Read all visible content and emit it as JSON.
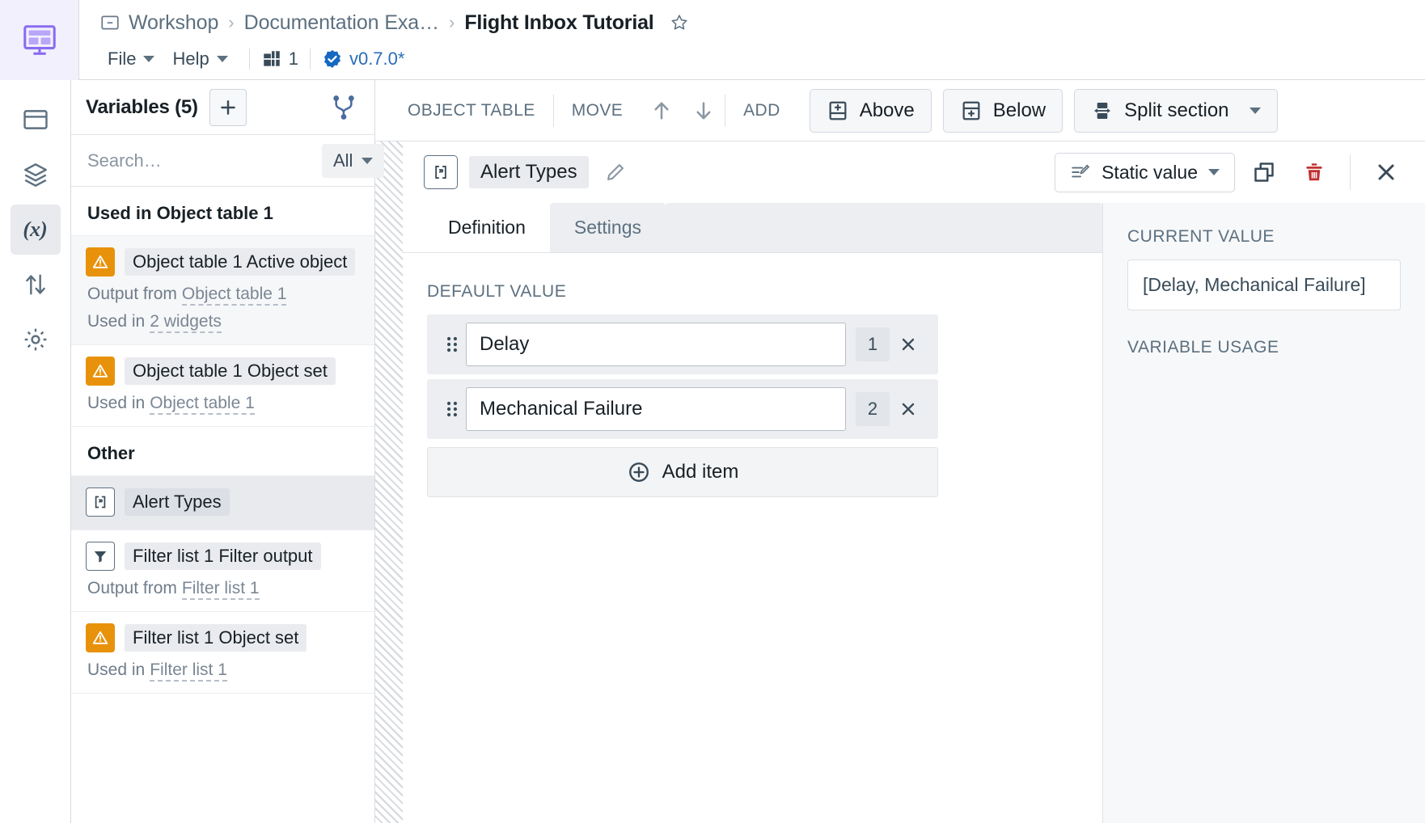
{
  "app": {
    "logo_icon": "workshop-layout-icon"
  },
  "breadcrumb": {
    "folder_icon": "folder-icon",
    "items": [
      {
        "label": "Workshop"
      },
      {
        "label": "Documentation Exa…"
      }
    ],
    "separator": "›",
    "current": "Flight Inbox Tutorial",
    "star_icon": "star-outline-icon"
  },
  "menubar": {
    "items": [
      {
        "label": "File",
        "icon": "chevron-down-icon"
      },
      {
        "label": "Help",
        "icon": "chevron-down-icon"
      }
    ],
    "layout_icon": "layout-grid-icon",
    "layout_count": "1",
    "version_icon": "verified-badge-icon",
    "version_label": "v0.7.0*"
  },
  "rail": {
    "items": [
      {
        "name": "layout-panel-icon",
        "active": false
      },
      {
        "name": "layers-icon",
        "active": false
      },
      {
        "name": "variables-icon",
        "active": true,
        "glyph": "(x)"
      },
      {
        "name": "transfer-arrows-icon",
        "active": false
      },
      {
        "name": "gear-icon",
        "active": false
      }
    ]
  },
  "variables_panel": {
    "title": "Variables (5)",
    "add_icon": "plus-icon",
    "add_label": "+",
    "branch_icon": "branch-icon",
    "search": {
      "placeholder": "Search…",
      "value": ""
    },
    "filter": {
      "label": "All",
      "icon": "chevron-down-icon"
    },
    "groups": [
      {
        "title": "Used in Object table 1",
        "items": [
          {
            "icon": "warning-triangle-icon",
            "icon_kind": "warn",
            "name": "Object table 1 Active object",
            "selected": false,
            "tinted": true,
            "meta": [
              {
                "prefix": "Output from",
                "link": "Object table 1"
              },
              {
                "prefix": "Used in",
                "link": "2 widgets"
              }
            ]
          },
          {
            "icon": "warning-triangle-icon",
            "icon_kind": "warn",
            "name": "Object table 1 Object set",
            "selected": false,
            "tinted": false,
            "meta": [
              {
                "prefix": "Used in",
                "link": "Object table 1"
              }
            ]
          }
        ]
      },
      {
        "title": "Other",
        "items": [
          {
            "icon": "variable-bracket-icon",
            "icon_kind": "outline",
            "name": "Alert Types",
            "selected": true,
            "tinted": false,
            "meta": []
          },
          {
            "icon": "filter-funnel-icon",
            "icon_kind": "outline",
            "name": "Filter list 1 Filter output",
            "selected": false,
            "tinted": false,
            "meta": [
              {
                "prefix": "Output from",
                "link": "Filter list 1"
              }
            ]
          },
          {
            "icon": "warning-triangle-icon",
            "icon_kind": "warn",
            "name": "Filter list 1 Object set",
            "selected": false,
            "tinted": false,
            "meta": [
              {
                "prefix": "Used in",
                "link": "Filter list 1"
              }
            ]
          }
        ]
      }
    ]
  },
  "section_toolbar": {
    "object_table_label": "OBJECT TABLE",
    "move_label": "MOVE",
    "move_up_icon": "arrow-up-icon",
    "move_down_icon": "arrow-down-icon",
    "add_label": "ADD",
    "above_label": "Above",
    "above_icon": "add-above-icon",
    "below_label": "Below",
    "below_icon": "add-below-icon",
    "split_label": "Split section",
    "split_icon": "split-section-icon",
    "split_caret_icon": "chevron-down-icon"
  },
  "variable_editor": {
    "icon": "variable-bracket-icon",
    "name": "Alert Types",
    "edit_icon": "pencil-icon",
    "value_type": {
      "label": "Static value",
      "icon": "static-value-icon",
      "caret_icon": "chevron-down-icon"
    },
    "duplicate_icon": "duplicate-icon",
    "delete_icon": "trash-icon",
    "close_icon": "close-icon",
    "tabs": [
      {
        "label": "Definition",
        "active": true
      },
      {
        "label": "Settings",
        "active": false
      }
    ],
    "default_value_label": "DEFAULT VALUE",
    "items": [
      {
        "drag_icon": "drag-handle-icon",
        "value": "Delay",
        "index": "1",
        "remove_icon": "close-icon"
      },
      {
        "drag_icon": "drag-handle-icon",
        "value": "Mechanical Failure",
        "index": "2",
        "remove_icon": "close-icon"
      }
    ],
    "add_item_label": "Add item",
    "add_item_icon": "plus-circle-icon"
  },
  "right_pane": {
    "current_value_label": "CURRENT VALUE",
    "current_value": "[Delay, Mechanical Failure]",
    "variable_usage_label": "VARIABLE USAGE"
  },
  "colors": {
    "accent_purple": "#8a6cf0",
    "warn_orange": "#e8920b",
    "danger_red": "#c23030",
    "link_blue": "#2b6cb8",
    "text_dark": "#182026",
    "text_muted": "#5c7080"
  }
}
